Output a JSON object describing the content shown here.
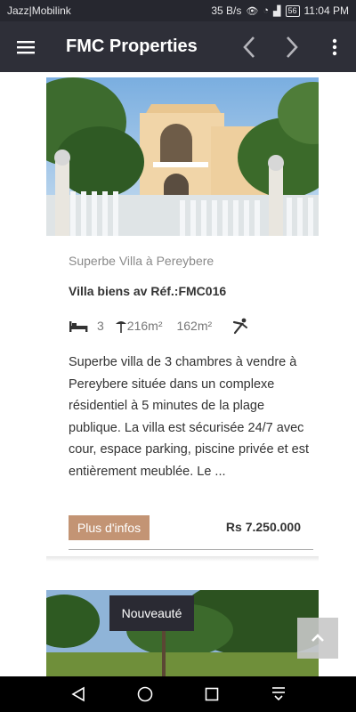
{
  "status": {
    "carrier": "Jazz|Mobilink",
    "speed": "35 B/s",
    "battery": "56",
    "time": "11:04 PM"
  },
  "app_bar": {
    "title": "FMC Properties",
    "icons": [
      "menu-icon",
      "chevron-left-icon",
      "chevron-right-icon",
      "more-vert-icon"
    ]
  },
  "listing": {
    "location": "Superbe Villa à Pereybere",
    "ref": "Villa biens av Réf.:FMC016",
    "bedrooms": "3",
    "land_area": "216m²",
    "built_area": "162m²",
    "description": "Superbe villa de 3 chambres à vendre à Pereybere située dans un complexe résidentiel à 5 minutes de la plage publique. La villa est sécurisée 24/7 avec cour, espace parking, piscine privée et est entièrement meublée. Le ...",
    "more_label": "Plus d'infos",
    "price": "Rs 7.250.000"
  },
  "next_listing": {
    "badge": "Nouveauté"
  },
  "colors": {
    "app_bar": "#2e2f38",
    "accent": "#c39474",
    "badge": "#2a2a33"
  }
}
